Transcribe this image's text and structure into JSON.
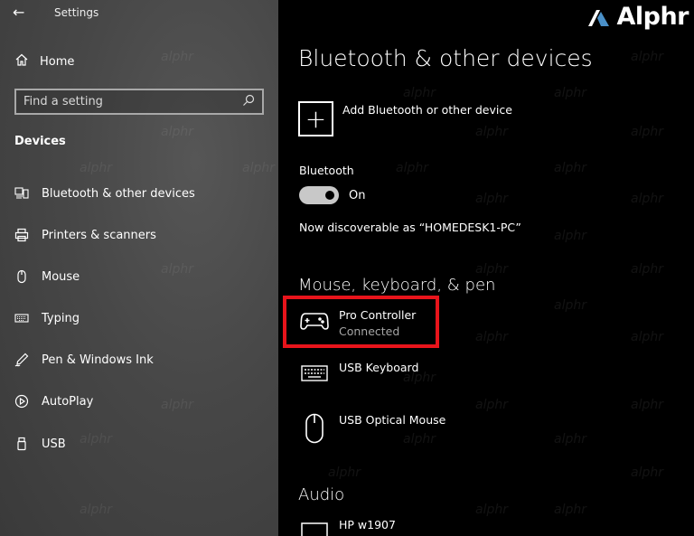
{
  "window": {
    "title": "Settings",
    "back_icon": "back-arrow-icon"
  },
  "sidebar": {
    "home": {
      "label": "Home",
      "icon": "home-icon"
    },
    "search": {
      "placeholder": "Find a setting",
      "icon": "search-icon"
    },
    "section": "Devices",
    "items": [
      {
        "label": "Bluetooth & other devices",
        "icon": "bluetooth-devices-icon"
      },
      {
        "label": "Printers & scanners",
        "icon": "printer-icon"
      },
      {
        "label": "Mouse",
        "icon": "mouse-icon"
      },
      {
        "label": "Typing",
        "icon": "keyboard-icon"
      },
      {
        "label": "Pen & Windows Ink",
        "icon": "pen-icon"
      },
      {
        "label": "AutoPlay",
        "icon": "autoplay-icon"
      },
      {
        "label": "USB",
        "icon": "usb-icon"
      }
    ]
  },
  "main": {
    "title": "Bluetooth & other devices",
    "add_device": "Add Bluetooth or other device",
    "bluetooth": {
      "label": "Bluetooth",
      "state": "On"
    },
    "discoverable": "Now discoverable as “HOMEDESK1-PC”",
    "sections": {
      "input": "Mouse, keyboard, & pen",
      "audio": "Audio"
    },
    "devices": [
      {
        "name": "Pro Controller",
        "status": "Connected",
        "icon": "gamepad-icon"
      },
      {
        "name": "USB Keyboard",
        "status": "",
        "icon": "keyboard-icon"
      },
      {
        "name": "USB Optical Mouse",
        "status": "",
        "icon": "mouse-icon"
      },
      {
        "name": "HP w1907",
        "status": "",
        "icon": "monitor-icon"
      }
    ]
  },
  "branding": {
    "logo_text": "Alphr",
    "watermark": "alphr"
  },
  "colors": {
    "highlight": "#e8141b",
    "sidebar_bg": "#474747",
    "main_bg": "#000000"
  }
}
